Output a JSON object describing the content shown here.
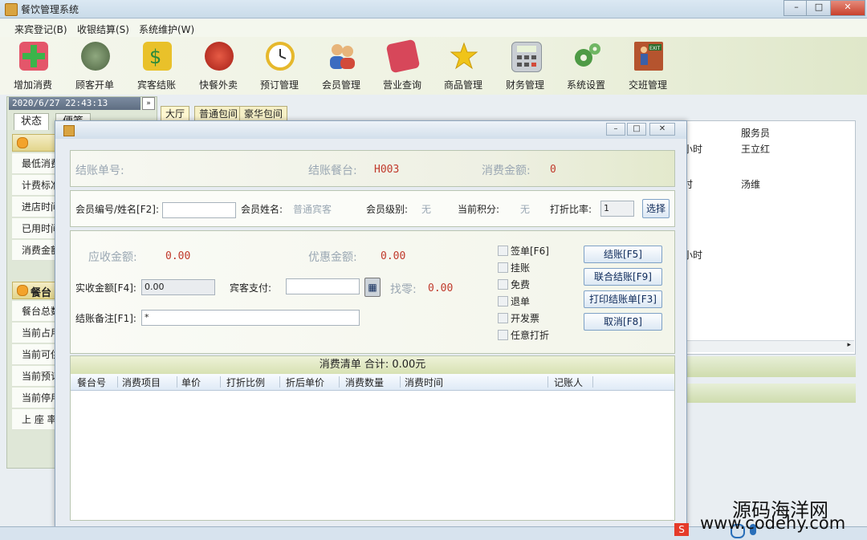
{
  "window": {
    "title": "餐饮管理系统"
  },
  "menu": [
    "来宾登记(B)",
    "收银结算(S)",
    "系统维护(W)"
  ],
  "toolbar": [
    {
      "label": "增加消费",
      "icon": "add-consumption-icon",
      "color": "#e4566a"
    },
    {
      "label": "顾客开单",
      "icon": "tea-bowl-icon",
      "color": "#5f7b4f"
    },
    {
      "label": "宾客结账",
      "icon": "checkout-money-icon",
      "color": "#e9c12a"
    },
    {
      "label": "快餐外卖",
      "icon": "takeout-icon",
      "color": "#d0342b"
    },
    {
      "label": "预订管理",
      "icon": "clock-icon",
      "color": "#e6b82c"
    },
    {
      "label": "会员管理",
      "icon": "members-icon",
      "color": "#3b6cc0"
    },
    {
      "label": "营业查询",
      "icon": "pencil-ruler-icon",
      "color": "#d7475a"
    },
    {
      "label": "商品管理",
      "icon": "star-icon",
      "color": "#f0c419"
    },
    {
      "label": "财务管理",
      "icon": "calculator-icon",
      "color": "#9aa1a8"
    },
    {
      "label": "系统设置",
      "icon": "gears-icon",
      "color": "#4e9a45"
    },
    {
      "label": "交班管理",
      "icon": "exit-door-icon",
      "color": "#b5542e"
    }
  ],
  "left": {
    "clock": "2020/6/27  22:43:13",
    "tabs": [
      "状态",
      "便笺"
    ],
    "sections": [
      {
        "items": [
          "最低消费",
          "计费标准",
          "进店时间",
          "已用时间",
          "消费金额"
        ]
      },
      {
        "title": "餐台",
        "items": [
          "餐台总数",
          "当前占用",
          "当前可供",
          "当前预订",
          "当前停用",
          "上 座 率"
        ]
      }
    ]
  },
  "right": {
    "tabs": [
      "大厅",
      "普通包间",
      "豪华包间"
    ],
    "col_header": "服务员",
    "cells": [
      "小时",
      "王立红",
      "时",
      "汤维",
      "小时"
    ]
  },
  "dialog": {
    "summary": {
      "bill_no_label": "结账单号:",
      "table_label": "结账餐台:",
      "table_value": "H003",
      "amount_label": "消费金额:",
      "amount_value": "0"
    },
    "member": {
      "id_label": "会员编号/姓名[F2]:",
      "id_value": "",
      "name_label": "会员姓名:",
      "name_value": "普通宾客",
      "level_label": "会员级别:",
      "level_value": "无",
      "points_label": "当前积分:",
      "points_value": "无",
      "discount_label": "打折比率:",
      "discount_value": "1",
      "select_button": "选择"
    },
    "pay": {
      "receivable_label": "应收金额:",
      "receivable_value": "0.00",
      "discount_amt_label": "优惠金额:",
      "discount_amt_value": "0.00",
      "received_label": "实收金额[F4]:",
      "received_value": "0.00",
      "guest_pay_label": "宾客支付:",
      "guest_pay_value": "",
      "change_label": "找零:",
      "change_value": "0.00",
      "note_label": "结账备注[F1]:",
      "note_value": "*"
    },
    "options": [
      "签单[F6]",
      "挂账",
      "免费",
      "退单",
      "开发票",
      "任意打折"
    ],
    "buttons": [
      "结账[F5]",
      "联合结账[F9]",
      "打印结账单[F3]",
      "取消[F8]"
    ],
    "list": {
      "header": "消费清单    合计: 0.00元",
      "columns": [
        "餐台号",
        "消费项目",
        "单价",
        "打折比例",
        "折后单价",
        "消费数量",
        "消费时间",
        "记账人"
      ]
    }
  },
  "watermark": {
    "line1": "源码海洋网",
    "line2": "www.codehy.com"
  }
}
